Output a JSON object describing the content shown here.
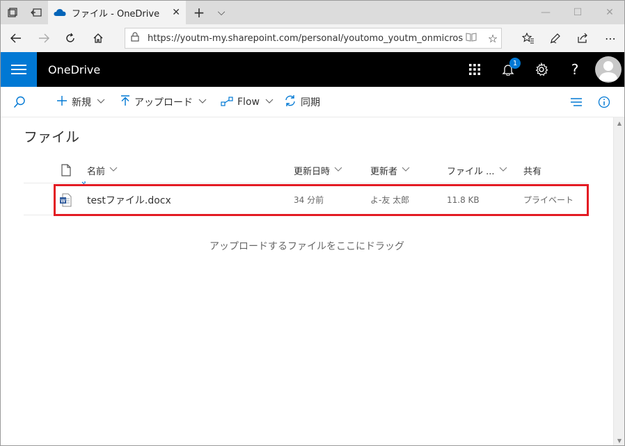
{
  "browser": {
    "tab_title": "ファイル - OneDrive",
    "url": "https://youtm-my.sharepoint.com/personal/youtomo_youtm_onmicrosoft_cc",
    "tab_close": "✕",
    "new_tab": "+",
    "tab_menu": "⌵"
  },
  "app": {
    "title": "OneDrive",
    "notification_count": "1",
    "help": "?",
    "accent": "#0078d4"
  },
  "toolbar": {
    "new_label": "新規",
    "upload_label": "アップロード",
    "flow_label": "Flow",
    "sync_label": "同期"
  },
  "page": {
    "title": "ファイル"
  },
  "columns": {
    "name": "名前",
    "modified": "更新日時",
    "modified_by": "更新者",
    "size": "ファイル ...",
    "sharing": "共有"
  },
  "files": [
    {
      "name": "testファイル.docx",
      "modified": "34 分前",
      "modified_by": "よ-友 太郎",
      "size": "11.8 KB",
      "sharing": "プライベート"
    }
  ],
  "drop_hint": "アップロードするファイルをここにドラッグ",
  "highlight_color": "#e31b23"
}
